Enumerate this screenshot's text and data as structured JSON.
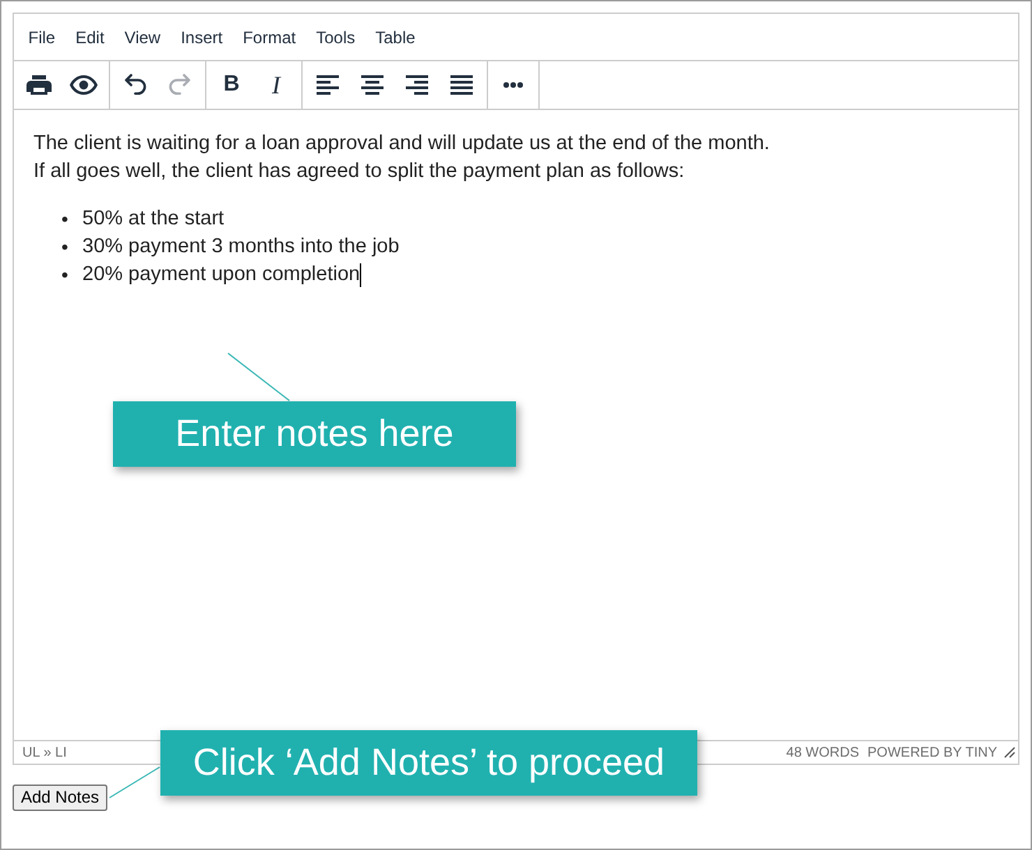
{
  "menu_bar": [
    "File",
    "Edit",
    "View",
    "Insert",
    "Format",
    "Tools",
    "Table"
  ],
  "toolbar": [
    {
      "tools": [
        {
          "kind": "print",
          "disabled": false
        },
        {
          "kind": "preview",
          "disabled": false
        }
      ]
    },
    {
      "tools": [
        {
          "kind": "undo",
          "disabled": false
        },
        {
          "kind": "redo",
          "disabled": true
        }
      ]
    },
    {
      "tools": [
        {
          "kind": "bold",
          "label": "B",
          "disabled": false
        },
        {
          "kind": "italic",
          "label": "I",
          "disabled": false
        }
      ]
    },
    {
      "tools": [
        {
          "kind": "align_left",
          "disabled": false
        },
        {
          "kind": "align_center",
          "disabled": false
        },
        {
          "kind": "align_right",
          "disabled": false
        },
        {
          "kind": "justify",
          "disabled": false
        }
      ]
    },
    {
      "tools": [
        {
          "kind": "more",
          "disabled": false
        }
      ]
    }
  ],
  "content": {
    "lines": [
      "The client is waiting for a loan approval and will update us at the end of the month.",
      "If all goes well, the client has agreed to split the payment plan as follows:"
    ],
    "bullets": [
      {
        "marker": "•",
        "text": "50% at the start",
        "caret": false
      },
      {
        "marker": "•",
        "text": "30% payment 3 months into the job",
        "caret": false
      },
      {
        "marker": "•",
        "text": "20% payment upon completion",
        "caret": true
      }
    ]
  },
  "status_bar": {
    "path": "UL » LI",
    "word_count": "48 WORDS",
    "branding": "POWERED BY TINY"
  },
  "add_button": "Add Notes",
  "callouts": [
    {
      "text": "Enter notes here"
    },
    {
      "text": "Click ‘Add Notes’ to proceed"
    }
  ]
}
